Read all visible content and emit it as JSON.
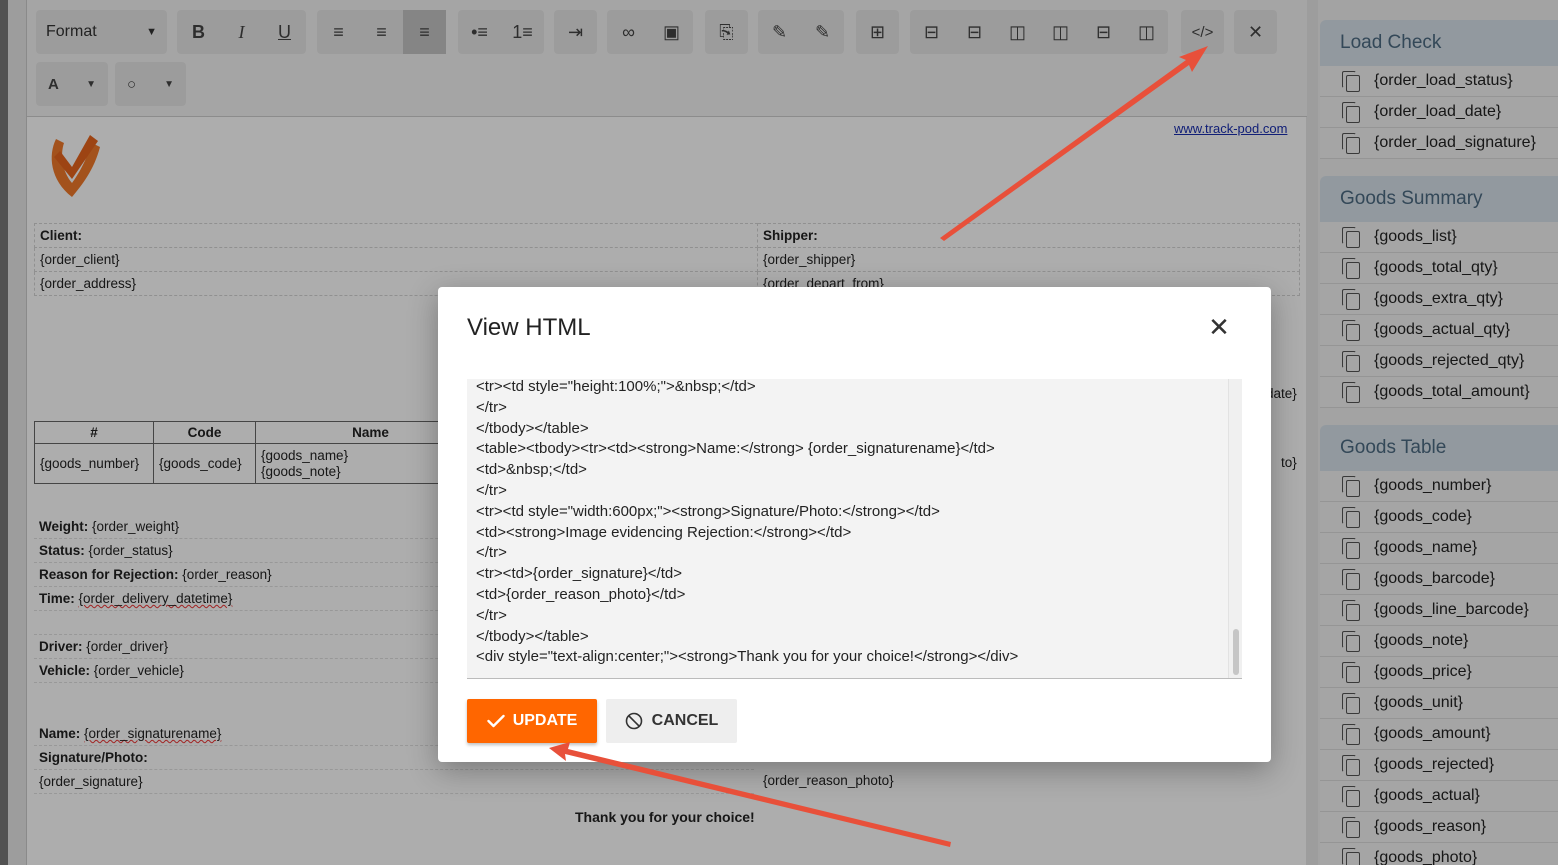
{
  "toolbar": {
    "format_label": "Format",
    "font_color_label": "A",
    "bg_color_label": "○",
    "buttons": [
      {
        "name": "bold-button",
        "glyph": "B"
      },
      {
        "name": "italic-button",
        "glyph": "I"
      },
      {
        "name": "underline-button",
        "glyph": "U"
      },
      {
        "name": "align-left-button",
        "glyph": "≡"
      },
      {
        "name": "align-center-button",
        "glyph": "≡"
      },
      {
        "name": "align-right-button",
        "glyph": "≡"
      },
      {
        "name": "bullet-list-button",
        "glyph": "•≡"
      },
      {
        "name": "numbered-list-button",
        "glyph": "1≡"
      },
      {
        "name": "indent-button",
        "glyph": "⇥"
      },
      {
        "name": "link-button",
        "glyph": "∞"
      },
      {
        "name": "image-button",
        "glyph": "▣"
      },
      {
        "name": "attach-button",
        "glyph": "⎘"
      },
      {
        "name": "edit-button",
        "glyph": "✎"
      },
      {
        "name": "edit2-button",
        "glyph": "✎"
      },
      {
        "name": "table-button",
        "glyph": "⊞"
      },
      {
        "name": "row-above-button",
        "glyph": "⊟"
      },
      {
        "name": "row-below-button",
        "glyph": "⊟"
      },
      {
        "name": "col-left-button",
        "glyph": "◫"
      },
      {
        "name": "col-right-button",
        "glyph": "◫"
      },
      {
        "name": "delete-row-button",
        "glyph": "⊟"
      },
      {
        "name": "delete-col-button",
        "glyph": "◫"
      },
      {
        "name": "view-html-button",
        "glyph": "</>"
      },
      {
        "name": "clear-format-button",
        "glyph": "✕"
      }
    ]
  },
  "document": {
    "link": "www.track-pod.com",
    "client_label": "Client:",
    "shipper_label": "Shipper:",
    "order_client": "{order_client}",
    "order_shipper": "{order_shipper}",
    "order_address": "{order_address}",
    "order_depart_from": "{order_depart_from}",
    "date_fragment": "date}",
    "goods_headers": [
      "#",
      "Code",
      "Name"
    ],
    "goods_row": [
      "{goods_number}",
      "{goods_code}",
      "{goods_name}",
      "{goods_note}"
    ],
    "to_fragment": "to}",
    "weight_label": "Weight:",
    "weight_value": "{order_weight}",
    "status_label": "Status:",
    "status_value": "{order_status}",
    "reason_label": "Reason for Rejection:",
    "reason_value": "{order_reason}",
    "time_label": "Time:",
    "time_value": "{order_delivery_datetime}",
    "driver_label": "Driver:",
    "driver_value": "{order_driver}",
    "vehicle_label": "Vehicle:",
    "vehicle_value": "{order_vehicle}",
    "name_label": "Name:",
    "name_value": "{order_signaturename}",
    "sig_label": "Signature/Photo:",
    "sig_value": "{order_signature}",
    "reason_photo": "{order_reason_photo}",
    "thanks": "Thank you for your choice!"
  },
  "modal": {
    "title": "View HTML",
    "close": "✕",
    "code_lines": [
      "<tr><td style=\"height:100%;\">&nbsp;</td>",
      "</tr>",
      "</tbody></table>",
      "<table><tbody><tr><td><strong>Name:</strong> {order_signaturename}</td>",
      "<td>&nbsp;</td>",
      "</tr>",
      "<tr><td style=\"width:600px;\"><strong>Signature/Photo:</strong></td>",
      "<td><strong>Image evidencing Rejection:</strong></td>",
      "</tr>",
      "<tr><td>{order_signature}</td>",
      "<td>{order_reason_photo}</td>",
      "</tr>",
      "</tbody></table>",
      "<div style=\"text-align:center;\"><strong>Thank you for your choice!</strong></div>"
    ],
    "update_label": "UPDATE",
    "cancel_label": "CANCEL"
  },
  "panel": {
    "sections": [
      {
        "title": "Load Check",
        "items": [
          "{order_load_status}",
          "{order_load_date}",
          "{order_load_signature}"
        ]
      },
      {
        "title": "Goods Summary",
        "items": [
          "{goods_list}",
          "{goods_total_qty}",
          "{goods_extra_qty}",
          "{goods_actual_qty}",
          "{goods_rejected_qty}",
          "{goods_total_amount}"
        ]
      },
      {
        "title": "Goods Table",
        "items": [
          "{goods_number}",
          "{goods_code}",
          "{goods_name}",
          "{goods_barcode}",
          "{goods_line_barcode}",
          "{goods_note}",
          "{goods_price}",
          "{goods_unit}",
          "{goods_amount}",
          "{goods_rejected}",
          "{goods_actual}",
          "{goods_reason}",
          "{goods_photo}"
        ]
      }
    ]
  },
  "colors": {
    "accent": "#ff6600",
    "arrow": "#e8503a",
    "panel_header": "#d8e2ea",
    "panel_header_text": "#4c6a82"
  }
}
